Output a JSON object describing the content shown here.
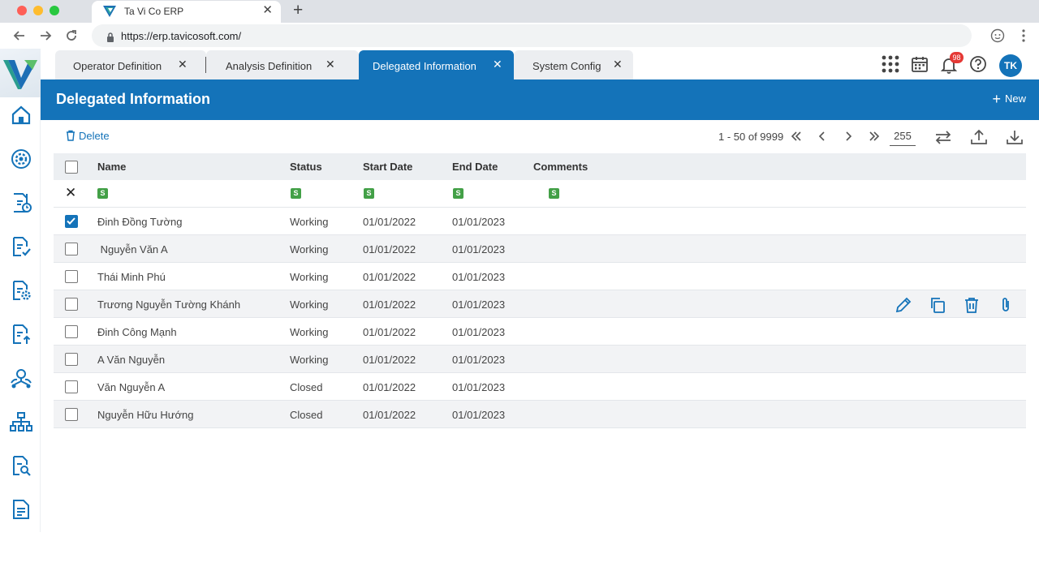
{
  "browser": {
    "tab_title": "Ta Vi Co ERP",
    "url": "https://erp.tavicosoft.com/"
  },
  "app_tabs": [
    {
      "label": "Operator Definition",
      "active": false
    },
    {
      "label": "Analysis Definition",
      "active": false
    },
    {
      "label": "Delegated Information",
      "active": true
    },
    {
      "label": "System Config",
      "active": false
    }
  ],
  "topbar": {
    "notification_count": "98",
    "avatar_initials": "TK"
  },
  "sidebar": {
    "icons": [
      "home-icon",
      "settings-cycle-icon",
      "document-clock-icon",
      "document-check-icon",
      "document-gear-icon",
      "document-upload-icon",
      "user-network-icon",
      "org-chart-icon",
      "document-search-icon",
      "document-icon"
    ]
  },
  "page": {
    "title": "Delegated Information",
    "new_label": "New",
    "delete_label": "Delete"
  },
  "pager": {
    "range_text": "1 - 50 of 9999",
    "page_size": "255"
  },
  "grid": {
    "columns": [
      "Name",
      "Status",
      "Start Date",
      "End Date",
      "Comments"
    ],
    "filter_tag": "S",
    "rows": [
      {
        "name": "Đinh Đồng Tường",
        "status": "Working",
        "start": "01/01/2022",
        "end": "01/01/2023",
        "comments": "",
        "checked": true
      },
      {
        "name": " Nguyễn Văn A",
        "status": "Working",
        "start": "01/01/2022",
        "end": "01/01/2023",
        "comments": "",
        "checked": false
      },
      {
        "name": "Thái Minh Phú",
        "status": "Working",
        "start": "01/01/2022",
        "end": "01/01/2023",
        "comments": "",
        "checked": false
      },
      {
        "name": "Trương Nguyễn Tường Khánh",
        "status": "Working",
        "start": "01/01/2022",
        "end": "01/01/2023",
        "comments": "",
        "checked": false
      },
      {
        "name": "Đinh Công Mạnh",
        "status": "Working",
        "start": "01/01/2022",
        "end": "01/01/2023",
        "comments": "",
        "checked": false
      },
      {
        "name": "A Văn Nguyễn",
        "status": "Working",
        "start": "01/01/2022",
        "end": "01/01/2023",
        "comments": "",
        "checked": false
      },
      {
        "name": "Văn Nguyễn A",
        "status": "Closed",
        "start": "01/01/2022",
        "end": "01/01/2023",
        "comments": "",
        "checked": false
      },
      {
        "name": "Nguyễn Hữu Hướng",
        "status": "Closed",
        "start": "01/01/2022",
        "end": "01/01/2023",
        "comments": "",
        "checked": false
      }
    ]
  },
  "colors": {
    "primary": "#1473b9",
    "filter_tag": "#43a047",
    "badge": "#e53935"
  }
}
